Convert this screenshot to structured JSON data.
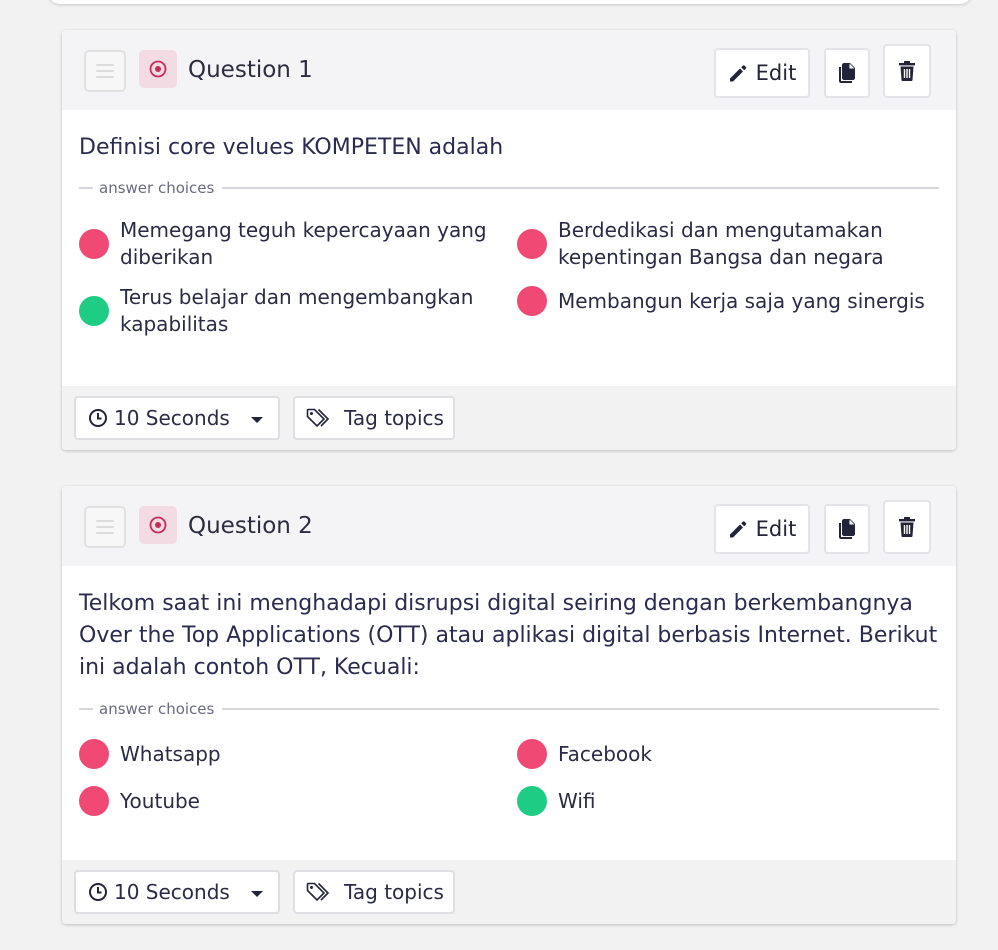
{
  "answer_choices_label": "answer choices",
  "colors": {
    "correct": "#1fcc84",
    "incorrect": "#f04a74",
    "type_badge": "#f3dbe3",
    "type_icon": "#c92d5c"
  },
  "questions": [
    {
      "title": "Question 1",
      "edit_label": "Edit",
      "text": "Definisi core velues KOMPETEN adalah",
      "choices": [
        {
          "text": "Memegang teguh kepercayaan yang diberikan",
          "correct": false
        },
        {
          "text": "Berdedikasi dan mengutamakan kepentingan Bangsa dan negara",
          "correct": false
        },
        {
          "text": "Terus belajar dan mengembangkan kapabilitas",
          "correct": true
        },
        {
          "text": "Membangun kerja saja yang sinergis",
          "correct": false
        }
      ],
      "time_label": "10 Seconds",
      "tag_label": "Tag topics"
    },
    {
      "title": "Question 2",
      "edit_label": "Edit",
      "text": "Telkom saat ini menghadapi disrupsi digital seiring dengan berkembangnya Over the Top Applications (OTT) atau aplikasi digital berbasis Internet. Berikut ini adalah contoh OTT, Kecuali:",
      "choices": [
        {
          "text": "Whatsapp",
          "correct": false
        },
        {
          "text": "Facebook",
          "correct": false
        },
        {
          "text": "Youtube",
          "correct": false
        },
        {
          "text": "Wifi",
          "correct": true
        }
      ],
      "time_label": "10 Seconds",
      "tag_label": "Tag topics"
    }
  ],
  "icons": [
    "drag-handle-icon",
    "radio-target-icon",
    "pencil-icon",
    "copy-icon",
    "trash-icon",
    "clock-icon",
    "caret-down-icon",
    "tag-icon"
  ]
}
